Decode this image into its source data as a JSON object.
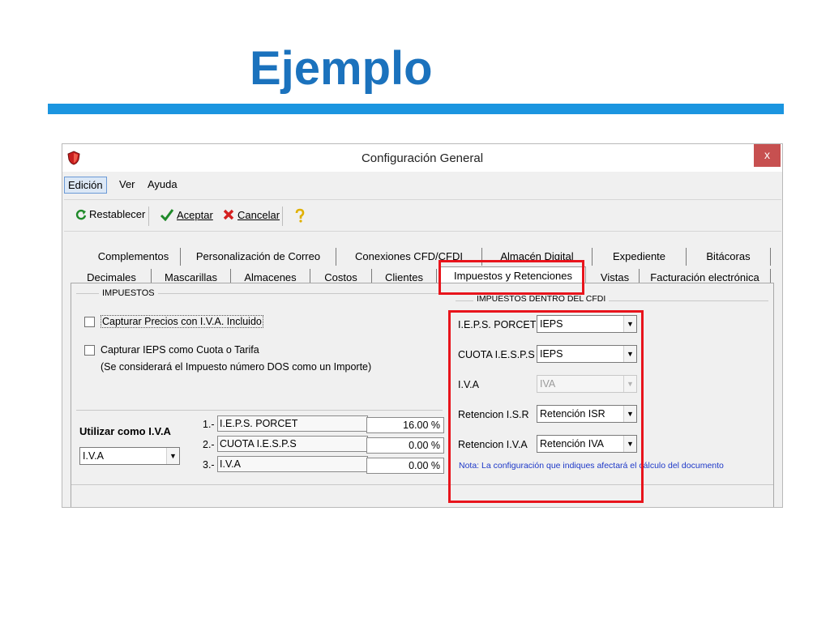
{
  "slide": {
    "title": "Ejemplo"
  },
  "window": {
    "title": "Configuración General",
    "close_label": "x"
  },
  "menu": [
    "Edición",
    "Ver",
    "Ayuda"
  ],
  "toolbar": {
    "restablecer": "Restablecer",
    "aceptar": "Aceptar",
    "cancelar": "Cancelar"
  },
  "tabs_top": [
    "Complementos",
    "Personalización de Correo",
    "Conexiones CFD/CFDI",
    "Almacén Digital",
    "Expediente",
    "Bitácoras"
  ],
  "tabs_bottom": [
    "Decimales",
    "Mascarillas",
    "Almacenes",
    "Costos",
    "Clientes",
    "Impuestos y Retenciones",
    "Vistas",
    "Facturación electrónica"
  ],
  "impuestos": {
    "group_label": "IMPUESTOS",
    "chk1": "Capturar Precios con I.V.A. Incluido",
    "chk2": "Capturar IEPS como Cuota o Tarifa",
    "chk2_note": "(Se considerará el Impuesto número DOS como un Importe)"
  },
  "utilizar": {
    "label": "Utilizar como I.V.A",
    "value": "I.V.A"
  },
  "tax_rows": [
    {
      "num": "1.-",
      "name": "I.E.P.S. PORCET",
      "value": "16.00 %"
    },
    {
      "num": "2.-",
      "name": "CUOTA I.E.S.P.S",
      "value": "0.00 %"
    },
    {
      "num": "3.-",
      "name": "I.V.A",
      "value": "0.00 %"
    }
  ],
  "cfdi": {
    "group_label": "IMPUESTOS DENTRO DEL CFDI",
    "rows": [
      {
        "label": "I.E.P.S. PORCET",
        "value": "IEPS"
      },
      {
        "label": "CUOTA I.E.S.P.S",
        "value": "IEPS"
      },
      {
        "label": "I.V.A",
        "value": "IVA"
      },
      {
        "label": "Retencion I.S.R",
        "value": "Retención ISR"
      },
      {
        "label": "Retencion I.V.A",
        "value": "Retención IVA"
      }
    ],
    "note": "Nota: La configuración que indiques afectará el cálculo del documento"
  },
  "colors": {
    "accent_title": "#1b72bd",
    "accent_bar": "#1b95e0",
    "highlight": "#e8141c",
    "note_text": "#1d38c8"
  }
}
